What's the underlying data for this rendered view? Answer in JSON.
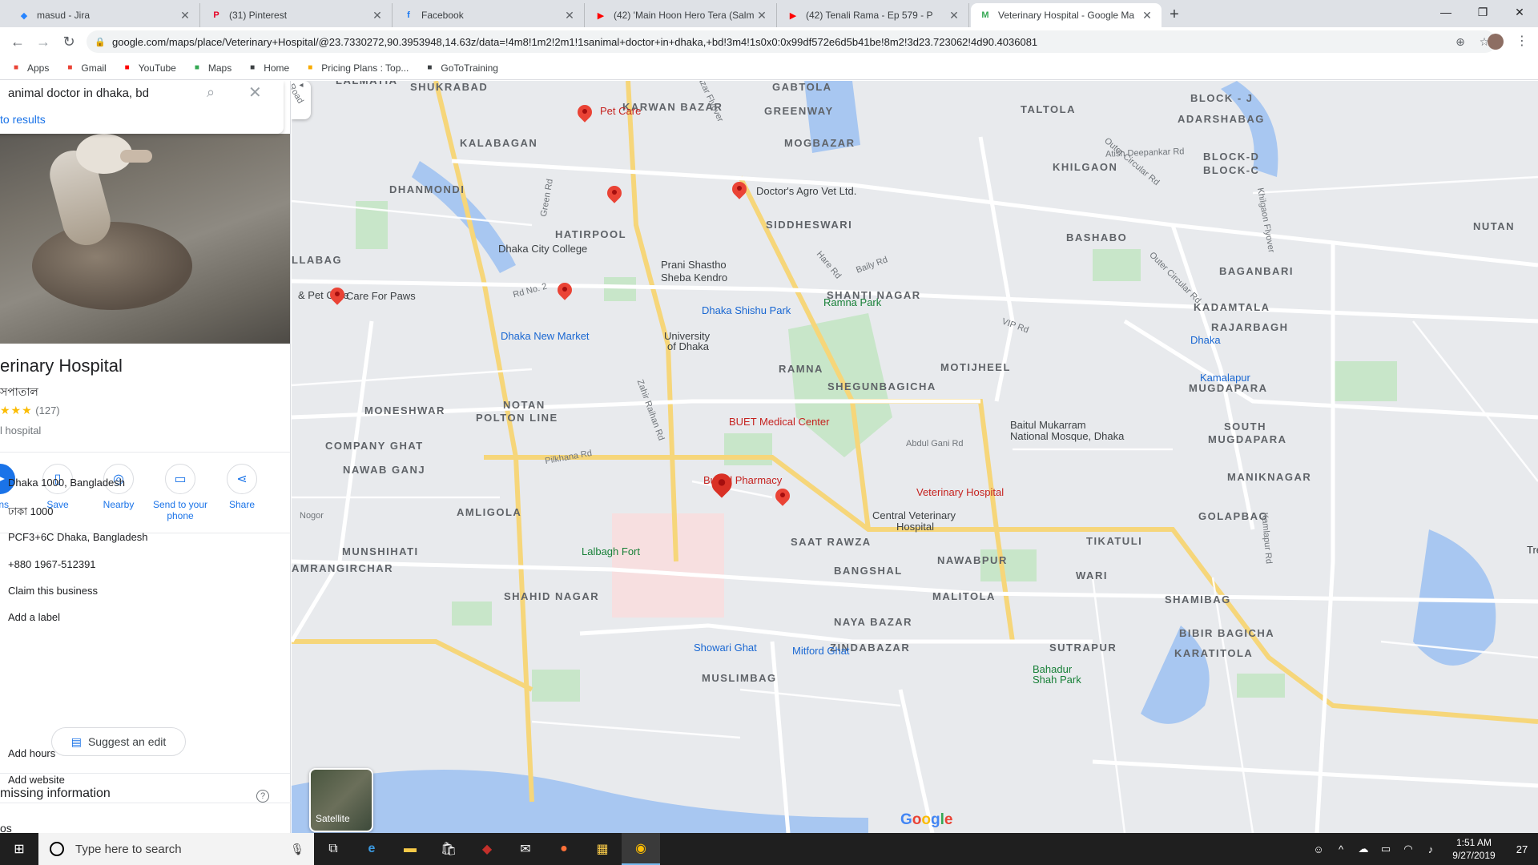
{
  "browser": {
    "tabs": [
      {
        "title": "masud - Jira",
        "fav": "◆",
        "favcolor": "#2684ff"
      },
      {
        "title": "(31) Pinterest",
        "fav": "P",
        "favcolor": "#e60023"
      },
      {
        "title": "Facebook",
        "fav": "f",
        "favcolor": "#1877f2"
      },
      {
        "title": "(42) 'Main Hoon Hero Tera (Salm",
        "fav": "▶",
        "favcolor": "#ff0000"
      },
      {
        "title": "(42) Tenali Rama - Ep 579 - P",
        "fav": "▶",
        "favcolor": "#ff0000"
      },
      {
        "title": "Veterinary Hospital - Google Ma",
        "fav": "M",
        "favcolor": "#34a853"
      }
    ],
    "url": "google.com/maps/place/Veterinary+Hospital/@23.7330272,90.3953948,14.63z/data=!4m8!1m2!2m1!1sanimal+doctor+in+dhaka,+bd!3m4!1s0x0:0x99df572e6d5b41be!8m2!3d23.723062!4d90.4036081",
    "bookmarks": [
      {
        "label": "Apps",
        "icon": "grid-icon",
        "color": "#ea4335"
      },
      {
        "label": "Gmail",
        "icon": "gmail-icon",
        "color": "#ea4335"
      },
      {
        "label": "YouTube",
        "icon": "youtube-icon",
        "color": "#ff0000"
      },
      {
        "label": "Maps",
        "icon": "maps-icon",
        "color": "#34a853"
      },
      {
        "label": "Home",
        "icon": "home-icon",
        "color": "#3c4043"
      },
      {
        "label": "Pricing Plans : Top...",
        "icon": "pricing-icon",
        "color": "#f9ab00"
      },
      {
        "label": "GoToTraining",
        "icon": "gototraining-icon",
        "color": "#3c4043"
      }
    ]
  },
  "panel": {
    "search_value": "animal doctor in dhaka, bd",
    "back_label": "to results",
    "title": "erinary Hospital",
    "subtitle": "সপাতাল",
    "rating_stars": "★★★",
    "rating_count": "(127)",
    "type": "l hospital",
    "actions": [
      {
        "label": "ions",
        "icon": "directions-icon"
      },
      {
        "label": "Save",
        "icon": "bookmark-icon"
      },
      {
        "label": "Nearby",
        "icon": "nearby-icon"
      },
      {
        "label": "Send to your phone",
        "icon": "send-to-phone-icon"
      },
      {
        "label": "Share",
        "icon": "share-icon"
      }
    ],
    "address_en": "Dhaka 1000, Bangladesh",
    "address_bn": "ঢাকা 1000",
    "plus_code": "PCF3+6C Dhaka, Bangladesh",
    "phone": "+880 1967-512391",
    "claim": "Claim this business",
    "add_label": "Add a label",
    "suggest_edit": "Suggest an edit",
    "missing_title": "missing information",
    "add_hours": "Add hours",
    "add_website": "Add website",
    "footer_partial": "os"
  },
  "map": {
    "areas": [
      {
        "n": "LALMATIA"
      },
      {
        "n": "SHUKRABAD"
      },
      {
        "n": "KARWAN BAZAR"
      },
      {
        "n": "GABTOLA"
      },
      {
        "n": "GREENWAY"
      },
      {
        "n": "TALTOLA"
      },
      {
        "n": "BLOCK - J"
      },
      {
        "n": "ADARSHABAG"
      },
      {
        "n": "KALABAGAN"
      },
      {
        "n": "MOGBAZAR"
      },
      {
        "n": "KHILGAON"
      },
      {
        "n": "BLOCK-D"
      },
      {
        "n": "BLOCK-C"
      },
      {
        "n": "DHANMONDI"
      },
      {
        "n": "SIDDHESWARI"
      },
      {
        "n": "NUTAN"
      },
      {
        "n": "HATIRPOOL"
      },
      {
        "n": "BASHABO"
      },
      {
        "n": "LLABAG"
      },
      {
        "n": "BAGANBARI"
      },
      {
        "n": "SHANTI NAGAR"
      },
      {
        "n": "KADAMTALA"
      },
      {
        "n": "RAJARBAGH"
      },
      {
        "n": "RAMNA"
      },
      {
        "n": "MOTIJHEEL"
      },
      {
        "n": "SHEGUNBAGICHA"
      },
      {
        "n": "MUGDAPARA"
      },
      {
        "n": "MONESHWAR"
      },
      {
        "n": "NOTAN"
      },
      {
        "n": "POLTON LINE"
      },
      {
        "n": "SOUTH"
      },
      {
        "n": "MUGDAPARA"
      },
      {
        "n": "COMPANY GHAT"
      },
      {
        "n": "NAWAB GANJ"
      },
      {
        "n": "MANIKNAGAR"
      },
      {
        "n": "AMLIGOLA"
      },
      {
        "n": "GOLAPBAG"
      },
      {
        "n": "SAAT RAWZA"
      },
      {
        "n": "TIKATULI"
      },
      {
        "n": "MUNSHIHATI"
      },
      {
        "n": "NAWABPUR"
      },
      {
        "n": "AMRANGIRCHAR"
      },
      {
        "n": "BANGSHAL"
      },
      {
        "n": "WARI"
      },
      {
        "n": "SHAHID NAGAR"
      },
      {
        "n": "MALITOLA"
      },
      {
        "n": "SHAMIBAG"
      },
      {
        "n": "NAYA BAZAR"
      },
      {
        "n": "BIBIR BAGICHA"
      },
      {
        "n": "ZINDABAZAR"
      },
      {
        "n": "SUTRAPUR"
      },
      {
        "n": "KARATITOLA"
      },
      {
        "n": "MUSLIMBAG"
      }
    ],
    "pois": [
      {
        "n": "Pet Care",
        "c": "red"
      },
      {
        "n": "Doctor's Agro Vet Ltd.",
        "c": "dark"
      },
      {
        "n": "Dhaka City College",
        "c": "dark"
      },
      {
        "n": "Prani Shastho",
        "c": "dark"
      },
      {
        "n": "Sheba Kendro",
        "c": "dark"
      },
      {
        "n": "& Pet Care",
        "c": "dark"
      },
      {
        "n": "Care For Paws",
        "c": "dark"
      },
      {
        "n": "Dhaka Shishu Park",
        "c": "blue"
      },
      {
        "n": "Ramna Park",
        "c": "green"
      },
      {
        "n": "Dhaka New Market",
        "c": "blue"
      },
      {
        "n": "University",
        "c": "dark"
      },
      {
        "n": "of Dhaka",
        "c": "dark"
      },
      {
        "n": "Dhaka",
        "c": "blue"
      },
      {
        "n": "Kamalapur",
        "c": "blue"
      },
      {
        "n": "BUET Medical Center",
        "c": "red"
      },
      {
        "n": "Baitul Mukarram",
        "c": "dark"
      },
      {
        "n": "National Mosque, Dhaka",
        "c": "dark"
      },
      {
        "n": "Bulbul Pharmacy",
        "c": "red"
      },
      {
        "n": "Veterinary Hospital",
        "c": "red"
      },
      {
        "n": "Central Veterinary",
        "c": "dark"
      },
      {
        "n": "Hospital",
        "c": "dark"
      },
      {
        "n": "Lalbagh Fort",
        "c": "green"
      },
      {
        "n": "Showari Ghat",
        "c": "blue"
      },
      {
        "n": "Mitford Ghat",
        "c": "blue"
      },
      {
        "n": "Bahadur",
        "c": "green"
      },
      {
        "n": "Shah Park",
        "c": "green"
      },
      {
        "n": "Trea",
        "c": "dark"
      }
    ],
    "roads": [
      {
        "n": "Atish Deepankar Rd"
      },
      {
        "n": "Outer Circular Rd"
      },
      {
        "n": "Hare Rd"
      },
      {
        "n": "Baily Rd"
      },
      {
        "n": "Rd No. 2"
      },
      {
        "n": "VIP Rd"
      },
      {
        "n": "Abdul Gani Rd"
      },
      {
        "n": "Green Rd"
      },
      {
        "n": "Zahir Raihan Rd"
      },
      {
        "n": "Pilkhana Rd"
      },
      {
        "n": "Kamlapur Rd"
      },
      {
        "n": "Khilgaon Flyover"
      },
      {
        "n": "Tejturi Mogbazar Flyover"
      },
      {
        "n": "Outer Circular Rd"
      },
      {
        "n": "Road"
      },
      {
        "n": "Nogor"
      }
    ],
    "satellite_label": "Satellite",
    "google_logo": "Google"
  },
  "taskbar": {
    "search_placeholder": "Type here to search",
    "time": "1:51 AM",
    "date": "9/27/2019",
    "notif_count": "27"
  }
}
